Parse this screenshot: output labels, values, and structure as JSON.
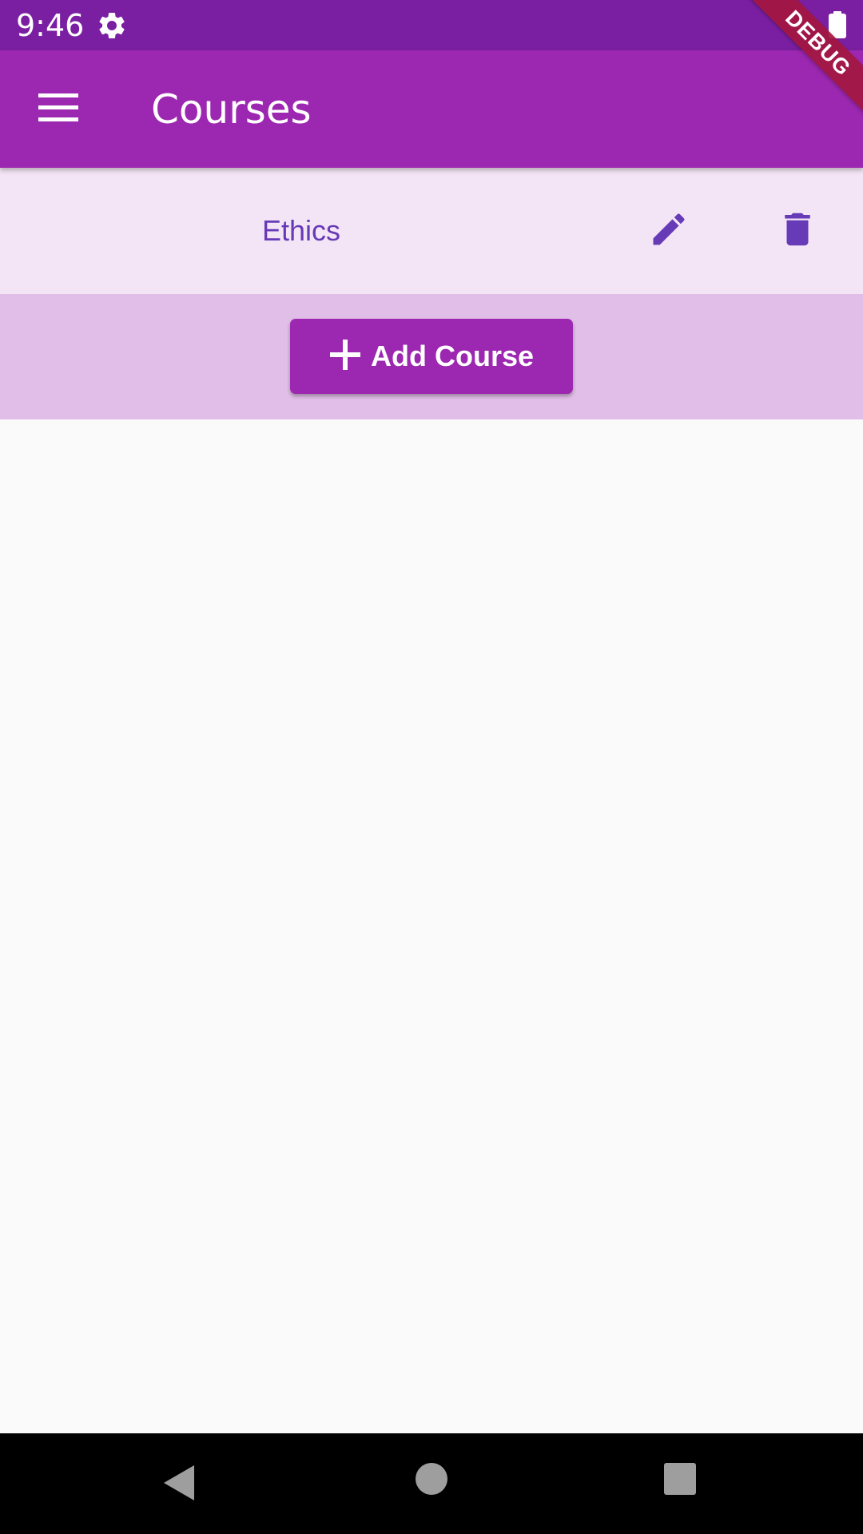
{
  "status_bar": {
    "time": "9:46",
    "icons": [
      "gear-icon",
      "battery-icon"
    ]
  },
  "app_bar": {
    "title": "Courses",
    "menu_icon": "menu-icon"
  },
  "courses": [
    {
      "name": "Ethics",
      "edit_icon": "pencil-icon",
      "delete_icon": "trash-icon"
    }
  ],
  "add_course": {
    "label": "Add Course",
    "icon": "plus-icon"
  },
  "debug_banner": {
    "label": "DEBUG"
  },
  "nav_bar": {
    "icons": [
      "back-icon",
      "home-icon",
      "recents-icon"
    ]
  },
  "colors": {
    "status_bar": "#7b1fa2",
    "primary": "#9c27b0",
    "course_row_bg": "#f3e5f5",
    "add_area_bg": "#e1bee7",
    "accent_text": "#673ab7",
    "debug_banner": "#a3173f",
    "page_bg": "#fafafa"
  }
}
